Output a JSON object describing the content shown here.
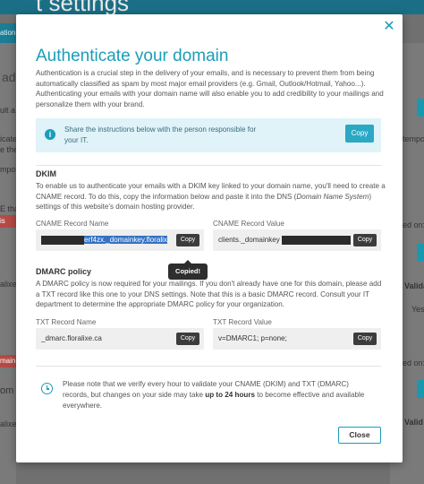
{
  "background": {
    "page_title": "t settings",
    "nav_fragment": "ation",
    "left_fragments": [
      "ad",
      "ult a",
      "icate",
      "e the",
      "mpo",
      "E tha",
      "om",
      "alixe.com",
      "main is",
      "alixe.ca"
    ],
    "right_fragments": [
      "tempo",
      "ed on: M",
      "Valida",
      "Yes",
      "ed on: M",
      "Valid"
    ],
    "alert_fragment": "is"
  },
  "modal": {
    "title": "Authenticate your domain",
    "intro": "Authentication is a crucial step in the delivery of your emails, and is necessary to prevent them from being automatically classified as spam by most major email providers (e.g. Gmail, Outlook/Hotmail, Yahoo...). Authenticating your emails with your domain name will also enable you to add credibility to your mailings and personalize them with your brand.",
    "info": {
      "text": "Share the instructions below with the person responsible for your IT.",
      "copy_label": "Copy"
    },
    "dkim": {
      "heading": "DKIM",
      "text_before": "To enable us to authenticate your emails with a DKIM key linked to your domain name, you'll need to create a CNAME record. To do this, copy the information below and paste it into the DNS (",
      "text_italic": "Domain Name System",
      "text_after": ") settings of this website's domain hosting provider.",
      "name_label": "CNAME Record Name",
      "name_value_tail": "erf4zx._domainkey.floralix",
      "value_label": "CNAME Record Value",
      "value_prefix": "clients._domainkey",
      "copy_label": "Copy",
      "tooltip": "Copied!"
    },
    "dmarc": {
      "heading": "DMARC policy",
      "text": "A DMARC policy is now required for your mailings. If you don't already have one for this domain, please add a TXT record like this one to your DNS settings. Note that this is a basic DMARC record. Consult your IT department to determine the appropriate DMARC policy for your organization.",
      "name_label": "TXT Record Name",
      "name_value": "_dmarc.floralixe.ca",
      "value_label": "TXT Record Value",
      "value_value": "v=DMARC1; p=none;",
      "copy_label": "Copy"
    },
    "note": {
      "text_before": "Please note that we verify every hour to validate your CNAME (DKIM) and TXT (DMARC) records, but changes on your side may take ",
      "text_bold": "up to 24 hours",
      "text_after": " to become effective and available everywhere."
    },
    "close_label": "Close"
  }
}
